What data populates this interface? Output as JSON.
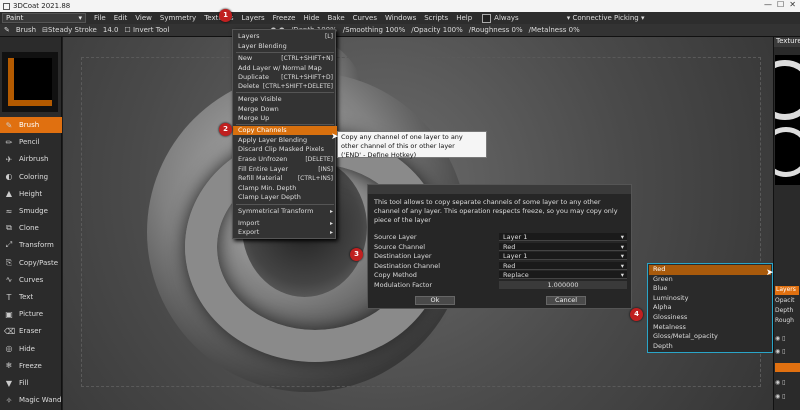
{
  "window": {
    "title": "3DCoat 2021.88"
  },
  "menubar": {
    "room": "Paint",
    "items": [
      "File",
      "Edit",
      "View",
      "Symmetry",
      "Textures",
      "Layers",
      "Freeze",
      "Hide",
      "Bake",
      "Curves",
      "Windows",
      "Scripts",
      "Help"
    ],
    "always_label": "Always",
    "picking": "Connective Picking"
  },
  "toolopts": {
    "tool": "Brush",
    "steady": "Steady Stroke",
    "steady_val": "14.0",
    "invert": "Invert Tool",
    "depth": "Depth",
    "depth_val": "100%",
    "smoothing": "Smoothing",
    "smoothing_val": "100%",
    "opacity": "Opacity",
    "opacity_val": "100%",
    "roughness": "Roughness",
    "roughness_val": "0%",
    "metalness": "Metalness",
    "metalness_val": "0%"
  },
  "tools": [
    "Brush",
    "Pencil",
    "Airbrush",
    "Coloring",
    "Height",
    "Smudge",
    "Clone",
    "Transform",
    "Copy/Paste",
    "Curves",
    "Text",
    "Picture",
    "Eraser",
    "Hide",
    "Freeze",
    "Fill",
    "Magic Wand"
  ],
  "tool_icons": [
    "brush-icon",
    "pencil-icon",
    "airbrush-icon",
    "coloring-icon",
    "height-icon",
    "smudge-icon",
    "clone-icon",
    "transform-icon",
    "copy-paste-icon",
    "curves-icon",
    "text-icon",
    "picture-icon",
    "eraser-icon",
    "hide-icon",
    "freeze-icon",
    "fill-icon",
    "magic-wand-icon"
  ],
  "layers_menu": [
    {
      "label": "Layers",
      "shortcut": "[L]"
    },
    {
      "label": "Layer Blending",
      "shortcut": ""
    },
    {
      "label": "New",
      "shortcut": "[CTRL+SHIFT+N]"
    },
    {
      "label": "Add Layer w/ Normal Map",
      "shortcut": ""
    },
    {
      "label": "Duplicate",
      "shortcut": "[CTRL+SHIFT+D]"
    },
    {
      "label": "Delete",
      "shortcut": "[CTRL+SHIFT+DELETE]"
    },
    {
      "label": "Merge Visible",
      "shortcut": ""
    },
    {
      "label": "Merge Down",
      "shortcut": ""
    },
    {
      "label": "Merge Up",
      "shortcut": ""
    },
    {
      "label": "Copy Channels",
      "shortcut": ""
    },
    {
      "label": "Apply Layer Blending",
      "shortcut": ""
    },
    {
      "label": "Discard Clip Masked Pixels",
      "shortcut": ""
    },
    {
      "label": "Erase Unfrozen",
      "shortcut": "[DELETE]"
    },
    {
      "label": "Fill Entire Layer",
      "shortcut": "[INS]"
    },
    {
      "label": "Refill Material",
      "shortcut": "[CTRL+INS]"
    },
    {
      "label": "Clamp Min. Depth",
      "shortcut": ""
    },
    {
      "label": "Clamp Layer Depth",
      "shortcut": ""
    },
    {
      "label": "Symmetrical Transform",
      "shortcut": "▸"
    },
    {
      "label": "Import",
      "shortcut": "▸"
    },
    {
      "label": "Export",
      "shortcut": "▸"
    }
  ],
  "tooltip": [
    "Copy any channel of one layer to any",
    "other channel of this or other layer",
    "('END' - Define Hotkey)"
  ],
  "dialog": {
    "description": "This tool allows to copy separate channels of some layer to any other channel of any layer. This operation respects freeze, so you may copy only piece of the layer",
    "fields": [
      {
        "label": "Source Layer",
        "value": "Layer 1"
      },
      {
        "label": "Source Channel",
        "value": "Red"
      },
      {
        "label": "Destination Layer",
        "value": "Layer 1"
      },
      {
        "label": "Destination Channel",
        "value": "Red"
      },
      {
        "label": "Copy Method",
        "value": "Replace"
      },
      {
        "label": "Modulation Factor",
        "value": "1.000000"
      }
    ],
    "ok": "Ok",
    "cancel": "Cancel"
  },
  "channel_list": [
    "Red",
    "Green",
    "Blue",
    "Luminosity",
    "Alpha",
    "Glossiness",
    "Metalness",
    "Gloss/Metal_opacity",
    "Depth"
  ],
  "right_panel": {
    "header": "Texture",
    "layers_tab": "Layers",
    "opacity": "Opacit",
    "depth": "Depth",
    "rough": "Rough"
  },
  "badges": [
    "1",
    "2",
    "3",
    "4"
  ]
}
